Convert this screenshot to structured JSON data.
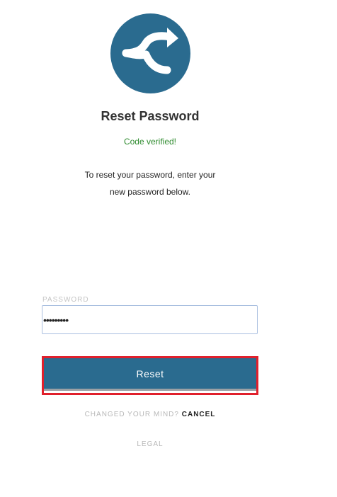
{
  "logo": {
    "icon": "split-arrow-logo-icon",
    "color": "#2a6b8f"
  },
  "header": {
    "title": "Reset Password"
  },
  "status": {
    "text": "Code verified!",
    "color": "#2e8b2e"
  },
  "instructions": {
    "line1": "To reset your password, enter your",
    "line2": "new password below."
  },
  "form": {
    "password_label": "PASSWORD",
    "password_value": "•••••••••",
    "submit_label": "Reset"
  },
  "footer": {
    "change_mind": "CHANGED YOUR MIND?",
    "cancel": "CANCEL",
    "legal": "LEGAL"
  },
  "colors": {
    "accent": "#2a6b8f",
    "highlight": "#e0202c"
  }
}
